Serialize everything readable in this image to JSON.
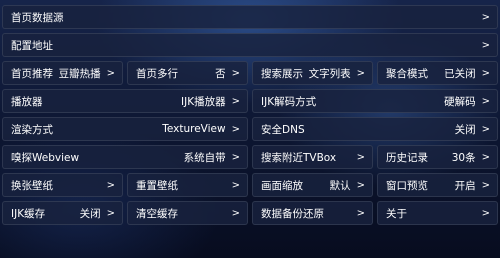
{
  "rows": [
    {
      "label": "首页数据源",
      "value": ""
    },
    {
      "label": "配置地址",
      "value": ""
    },
    [
      {
        "label": "首页推荐",
        "value": "豆瓣热播"
      },
      {
        "label": "首页多行",
        "value": "否"
      },
      {
        "label": "搜索展示",
        "value": "文字列表"
      },
      {
        "label": "聚合模式",
        "value": "已关闭"
      }
    ],
    [
      {
        "label": "播放器",
        "value": "IJK播放器"
      },
      {
        "label": "IJK解码方式",
        "value": "硬解码"
      }
    ],
    [
      {
        "label": "渲染方式",
        "value": "TextureView"
      },
      {
        "label": "安全DNS",
        "value": "关闭"
      }
    ],
    [
      {
        "label": "嗅探Webview",
        "value": "系统自带"
      },
      {
        "label": "搜索附近TVBox",
        "value": ""
      },
      {
        "label": "历史记录",
        "value": "30条"
      }
    ],
    [
      {
        "label": "换张壁纸",
        "value": ""
      },
      {
        "label": "重置壁纸",
        "value": ""
      },
      {
        "label": "画面缩放",
        "value": "默认"
      },
      {
        "label": "窗口预览",
        "value": "开启"
      }
    ],
    [
      {
        "label": "IJK缓存",
        "value": "关闭"
      },
      {
        "label": "清空缓存",
        "value": ""
      },
      {
        "label": "数据备份还原",
        "value": ""
      },
      {
        "label": "关于",
        "value": ""
      }
    ]
  ],
  "arrow_symbol": ">"
}
